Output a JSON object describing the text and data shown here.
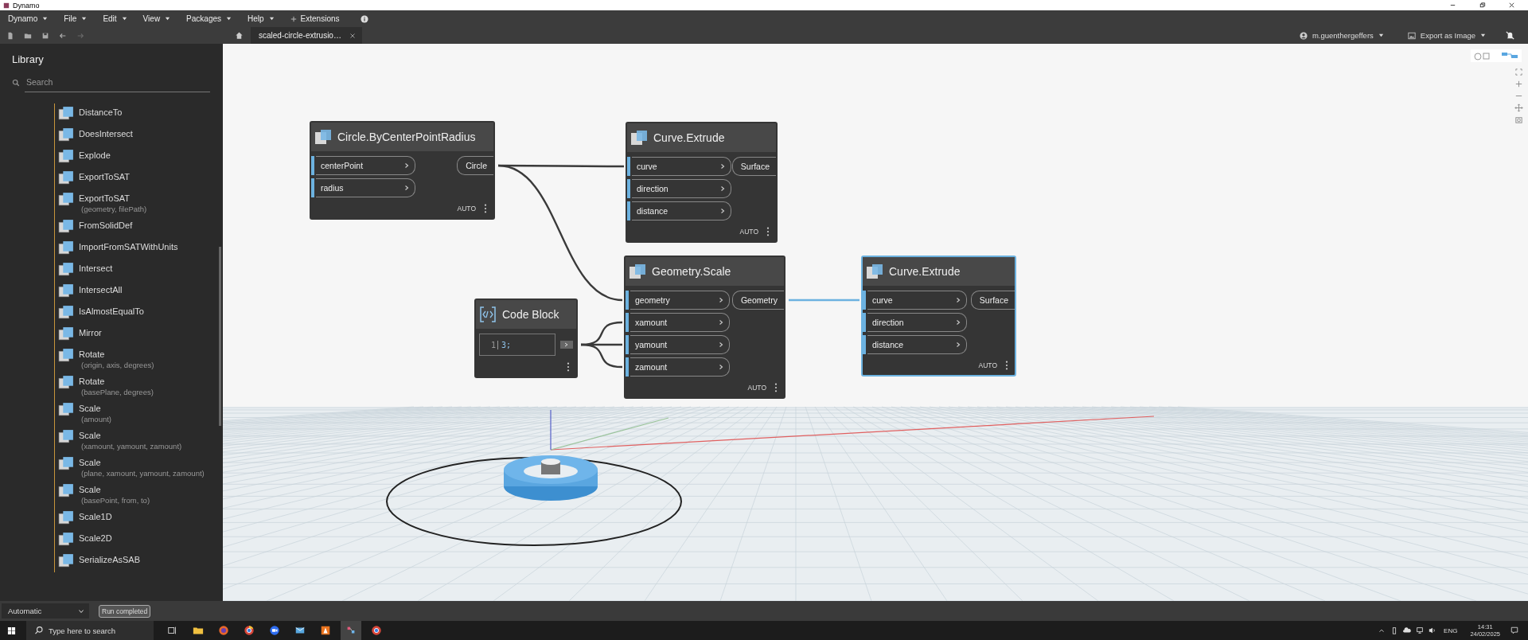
{
  "window": {
    "title": "Dynamo"
  },
  "menu": [
    {
      "label": "Dynamo"
    },
    {
      "label": "File"
    },
    {
      "label": "Edit"
    },
    {
      "label": "View"
    },
    {
      "label": "Packages"
    },
    {
      "label": "Help"
    }
  ],
  "extensions": "Extensions",
  "tab": {
    "title": "scaled-circle-extrusio…"
  },
  "user": "m.guenthergeffers",
  "export": "Export as Image",
  "library": {
    "title": "Library",
    "search_placeholder": "Search",
    "items": [
      {
        "name": "DistanceTo"
      },
      {
        "name": "DoesIntersect"
      },
      {
        "name": "Explode"
      },
      {
        "name": "ExportToSAT"
      },
      {
        "name": "ExportToSAT",
        "params": "(geometry, filePath)"
      },
      {
        "name": "FromSolidDef"
      },
      {
        "name": "ImportFromSATWithUnits"
      },
      {
        "name": "Intersect"
      },
      {
        "name": "IntersectAll"
      },
      {
        "name": "IsAlmostEqualTo"
      },
      {
        "name": "Mirror"
      },
      {
        "name": "Rotate",
        "params": "(origin, axis, degrees)"
      },
      {
        "name": "Rotate",
        "params": "(basePlane, degrees)"
      },
      {
        "name": "Scale",
        "params": "(amount)"
      },
      {
        "name": "Scale",
        "params": "(xamount, yamount, zamount)"
      },
      {
        "name": "Scale",
        "params": "(plane, xamount, yamount, zamount)"
      },
      {
        "name": "Scale",
        "params": "(basePoint, from, to)"
      },
      {
        "name": "Scale1D"
      },
      {
        "name": "Scale2D"
      },
      {
        "name": "SerializeAsSAB"
      }
    ]
  },
  "nodes": [
    {
      "kind": "function",
      "title": "Circle.ByCenterPointRadius",
      "inputs": [
        "centerPoint",
        "radius"
      ],
      "output": "Circle",
      "mode": "AUTO",
      "selected": false
    },
    {
      "kind": "function",
      "title": "Curve.Extrude",
      "inputs": [
        "curve",
        "direction",
        "distance"
      ],
      "output": "Surface",
      "mode": "AUTO",
      "selected": false
    },
    {
      "kind": "code",
      "title": "Code Block",
      "line_number": "1",
      "code": "3;",
      "selected": false
    },
    {
      "kind": "function",
      "title": "Geometry.Scale",
      "inputs": [
        "geometry",
        "xamount",
        "yamount",
        "zamount"
      ],
      "output": "Geometry",
      "mode": "AUTO",
      "selected": false
    },
    {
      "kind": "function",
      "title": "Curve.Extrude",
      "inputs": [
        "curve",
        "direction",
        "distance"
      ],
      "output": "Surface",
      "mode": "AUTO",
      "selected": true
    }
  ],
  "run_mode": "Automatic",
  "status": "Run completed",
  "taskbar": {
    "search_placeholder": "Type here to search",
    "language": "ENG",
    "time": "14:31",
    "date": "24/02/2025"
  }
}
